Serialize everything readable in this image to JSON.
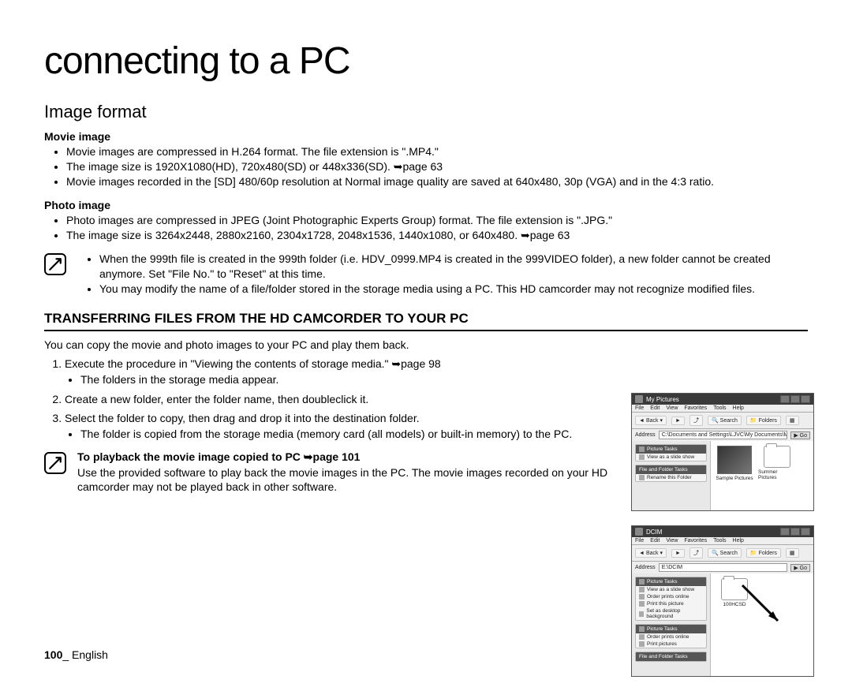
{
  "chapter_title": "connecting to a PC",
  "section_title": "Image format",
  "movie": {
    "heading": "Movie image",
    "items": [
      "Movie images are compressed in H.264 format. The file extension is \".MP4.\"",
      "The image size is 1920X1080(HD), 720x480(SD) or 448x336(SD). ➥page 63",
      "Movie images recorded in the [SD] 480/60p resolution at Normal image quality are saved at 640x480, 30p (VGA) and in the 4:3 ratio."
    ]
  },
  "photo": {
    "heading": "Photo image",
    "items": [
      "Photo images are compressed in JPEG (Joint Photographic Experts Group) format. The file extension is \".JPG.\"",
      "The image size is 3264x2448, 2880x2160, 2304x1728, 2048x1536, 1440x1080, or 640x480. ➥page 63"
    ]
  },
  "note": {
    "items": [
      "When the 999th file is created in the 999th folder (i.e. HDV_0999.MP4 is created in the 999VIDEO folder), a new folder cannot be created anymore. Set \"File No.\" to \"Reset\" at this time.",
      "You may modify the name of a file/folder stored in the storage media using a PC. This HD camcorder may not recognize modified files."
    ]
  },
  "transfer": {
    "title": "TRANSFERRING FILES FROM THE HD CAMCORDER TO YOUR PC",
    "intro": "You can copy the movie and photo images to your PC and play them back.",
    "steps": [
      {
        "text": "Execute the procedure in \"Viewing the contents of storage media.\" ➥page 98",
        "sub": [
          "The folders in the storage media appear."
        ]
      },
      {
        "text": "Create a new folder, enter the folder name, then doubleclick it.",
        "sub": []
      },
      {
        "text": "Select the folder to copy, then drag and drop it into the destination folder.",
        "sub": [
          "The folder is copied from the storage media (memory card (all models) or built-in memory) to the PC."
        ]
      }
    ]
  },
  "playback": {
    "heading": "To playback the movie image copied to PC ➥page 101",
    "body": "Use the provided software to play back the movie images in the PC. The movie images recorded on your HD camcorder may not be played back in other software."
  },
  "footer": {
    "page": "100",
    "sep": "_ ",
    "lang": "English"
  },
  "shot1": {
    "title": "My Pictures",
    "menu": [
      "File",
      "Edit",
      "View",
      "Favorites",
      "Tools",
      "Help"
    ],
    "toolbar": {
      "back": "Back",
      "search": "Search",
      "folders": "Folders"
    },
    "address_label": "Address",
    "address": "C:\\Documents and Settings\\LJVC\\My Documents\\My Pictures",
    "go": "Go",
    "side": {
      "picture_tasks": "Picture Tasks",
      "slideshow": "View as a slide show",
      "filefolder": "File and Folder Tasks",
      "rename": "Rename this Folder"
    },
    "thumbs": [
      "Sample Pictures",
      "Summer Pictures"
    ]
  },
  "shot2": {
    "title": "DCIM",
    "menu": [
      "File",
      "Edit",
      "View",
      "Favorites",
      "Tools",
      "Help"
    ],
    "toolbar": {
      "back": "Back",
      "search": "Search",
      "folders": "Folders"
    },
    "address_label": "Address",
    "address": "E:\\DCIM",
    "go": "Go",
    "side": {
      "picture_tasks": "Picture Tasks",
      "slideshow": "View as a slide show",
      "order_online": "Order prints online",
      "print_picture": "Print this picture",
      "set_desktop": "Set as desktop background",
      "picture_tasks2": "Picture Tasks",
      "order_online2": "Order prints online",
      "print_pictures": "Print pictures",
      "filefolder": "File and Folder Tasks"
    },
    "folder_name": "100HCSD"
  }
}
